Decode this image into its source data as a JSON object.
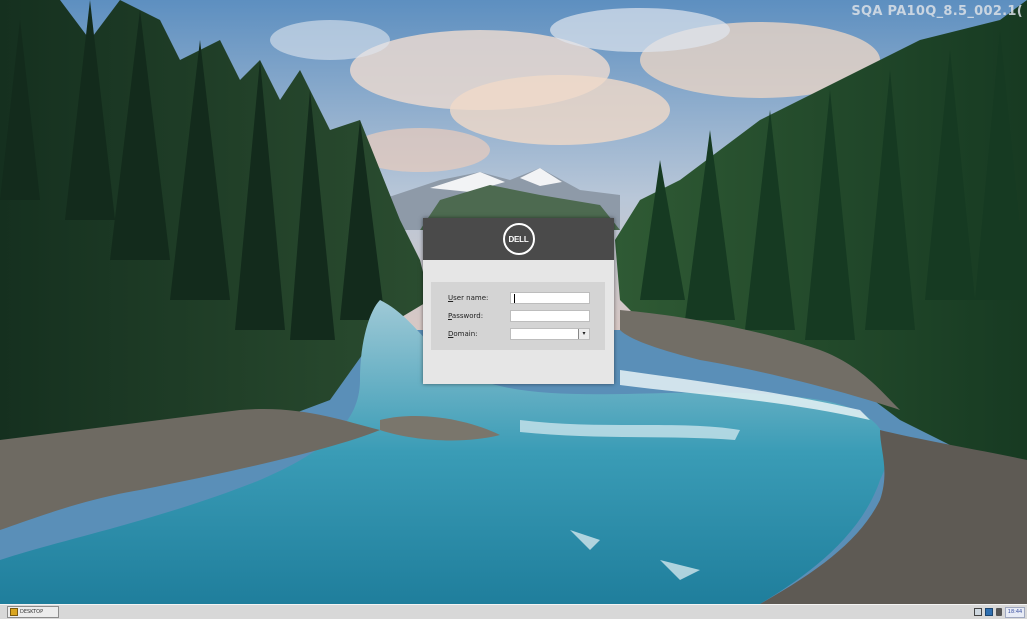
{
  "system": {
    "version_label": "SQA PA10Q_8.5_002.1("
  },
  "login": {
    "logo_text": "DELL",
    "fields": [
      {
        "label_accel": "U",
        "label_rest": "ser name:",
        "value": ""
      },
      {
        "label_accel": "P",
        "label_rest": "assword:",
        "value": ""
      },
      {
        "label_accel": "D",
        "label_rest": "omain:",
        "value": ""
      }
    ]
  },
  "taskbar": {
    "start_label": "DESKTOP",
    "clock": "18:44",
    "tray_icons": [
      "network-icon",
      "display-icon",
      "volume-icon"
    ]
  },
  "colors": {
    "dialog_header": "#4a4a4a",
    "dialog_body": "#e6e6e6",
    "taskbar": "#d8d8d8"
  }
}
